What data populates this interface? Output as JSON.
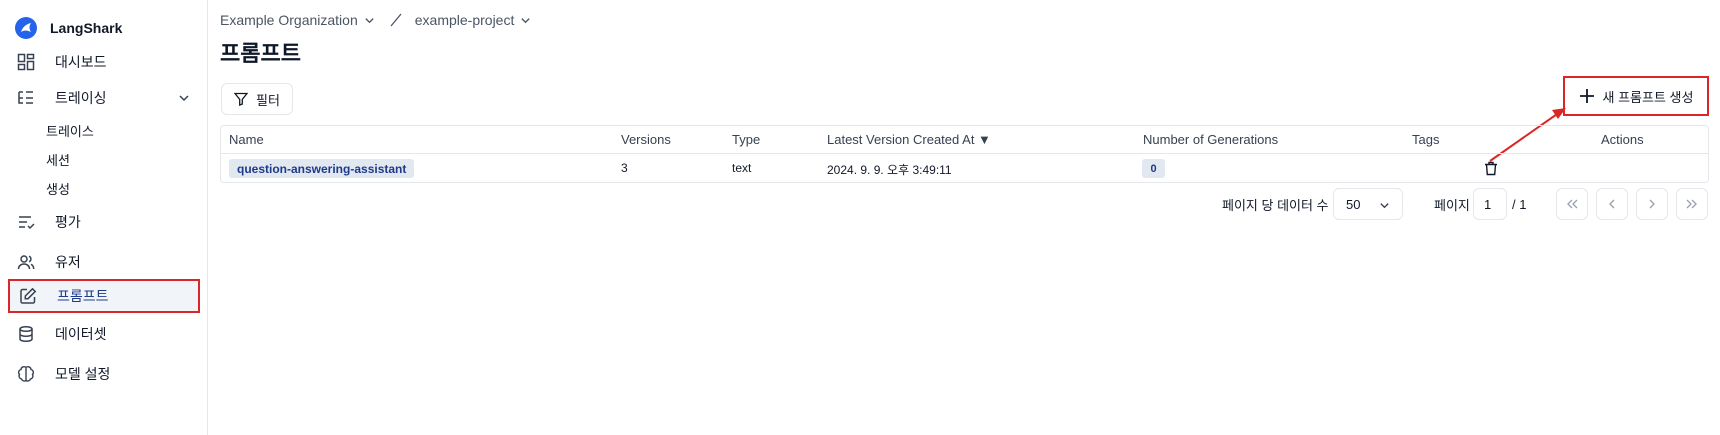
{
  "sidebar": {
    "brand": "LangShark",
    "items": [
      {
        "label": "대시보드",
        "icon": "dashboard-icon"
      },
      {
        "label": "트레이싱",
        "icon": "tracing-icon",
        "expanded": true,
        "children": [
          {
            "label": "트레이스"
          },
          {
            "label": "세션"
          },
          {
            "label": "생성"
          }
        ]
      },
      {
        "label": "평가",
        "icon": "evaluation-icon"
      },
      {
        "label": "유저",
        "icon": "users-icon"
      },
      {
        "label": "프롬프트",
        "icon": "edit-icon",
        "active": true
      },
      {
        "label": "데이터셋",
        "icon": "database-icon"
      },
      {
        "label": "모델 설정",
        "icon": "brain-icon"
      }
    ]
  },
  "breadcrumb": {
    "organization": "Example Organization",
    "project": "example-project"
  },
  "page": {
    "title": "프롬프트"
  },
  "toolbar": {
    "filter_label": "필터",
    "create_label": "새 프롬프트 생성"
  },
  "table": {
    "columns": [
      "Name",
      "Versions",
      "Type",
      "Latest Version Created At ▼",
      "Number of Generations",
      "Tags",
      "Actions"
    ],
    "rows": [
      {
        "name": "question-answering-assistant",
        "versions": "3",
        "type": "text",
        "created_at": "2024. 9. 9. 오후 3:49:11",
        "generations": "0",
        "tags": ""
      }
    ]
  },
  "pagination": {
    "rows_label": "페이지 당 데이터 수",
    "rows_value": "50",
    "page_label": "페이지",
    "page_value": "1",
    "page_total": "/ 1"
  },
  "colors": {
    "accent": "#2563eb",
    "highlight": "#dc2626",
    "pill_bg": "#e2e8f0",
    "pill_text": "#1e3a8a"
  }
}
